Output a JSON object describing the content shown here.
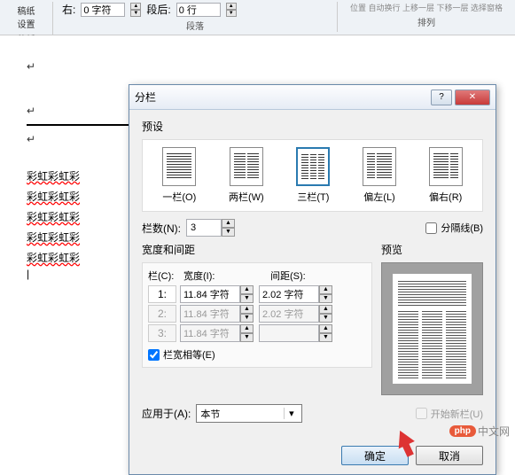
{
  "ribbon": {
    "draft_setup": "稿纸",
    "draft_setup2": "设置",
    "draft_label": "稿纸",
    "right_label": "右:",
    "right_val": "0 字符",
    "after_label": "段后:",
    "after_val": "0 行",
    "para_label": "段落",
    "arrange_items": "位置 自动换行 上移一层 下移一层 选择窗格",
    "arrange_label": "排列"
  },
  "doc": {
    "red_text": "彩虹彩虹彩"
  },
  "dialog": {
    "title": "分栏",
    "help": "?",
    "close": "✕",
    "preset_label": "预设",
    "presets": {
      "one": "一栏(O)",
      "two": "两栏(W)",
      "three": "三栏(T)",
      "left": "偏左(L)",
      "right": "偏右(R)"
    },
    "col_count_label": "栏数(N):",
    "col_count_val": "3",
    "divider_label": "分隔线(B)",
    "width_gap_label": "宽度和间距",
    "preview_label": "预览",
    "col_label": "栏(C):",
    "width_label": "宽度(I):",
    "gap_label": "间距(S):",
    "rows": [
      {
        "n": "1:",
        "w": "11.84 字符",
        "g": "2.02 字符"
      },
      {
        "n": "2:",
        "w": "11.84 字符",
        "g": "2.02 字符"
      },
      {
        "n": "3:",
        "w": "11.84 字符",
        "g": ""
      }
    ],
    "equal_width": "栏宽相等(E)",
    "apply_to_label": "应用于(A):",
    "apply_to_val": "本节",
    "new_col_label": "开始新栏(U)",
    "ok": "确定",
    "cancel": "取消"
  },
  "watermark": {
    "logo": "php",
    "text": "中文网"
  }
}
